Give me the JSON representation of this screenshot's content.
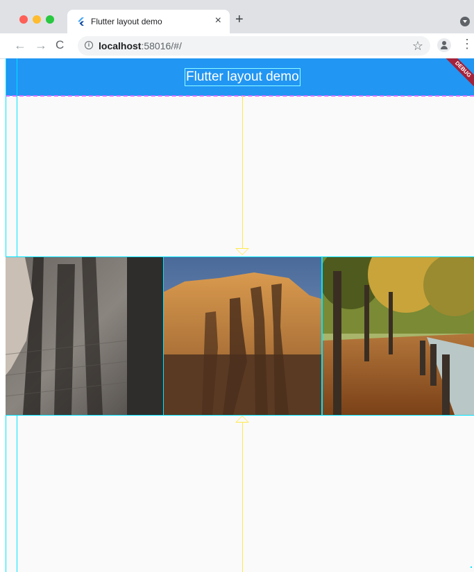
{
  "browser": {
    "tab_title": "Flutter layout demo",
    "tab_close": "×",
    "new_tab": "+",
    "back": "←",
    "forward": "→",
    "reload": "C",
    "url_host": "localhost",
    "url_rest": ":58016/#/",
    "bookmark": "☆",
    "menu": "⋮"
  },
  "app": {
    "title": "Flutter layout demo",
    "debug_banner": "DEBUG",
    "appbar_color": "#2196f3",
    "background": "#fafafa"
  },
  "images": [
    {
      "name": "shadows-on-pavement"
    },
    {
      "name": "shadows-on-rock"
    },
    {
      "name": "autumn-river-path"
    }
  ],
  "icons": [
    "info-icon",
    "star-icon",
    "profile-icon",
    "kebab-menu-icon",
    "flutter-logo-icon"
  ]
}
